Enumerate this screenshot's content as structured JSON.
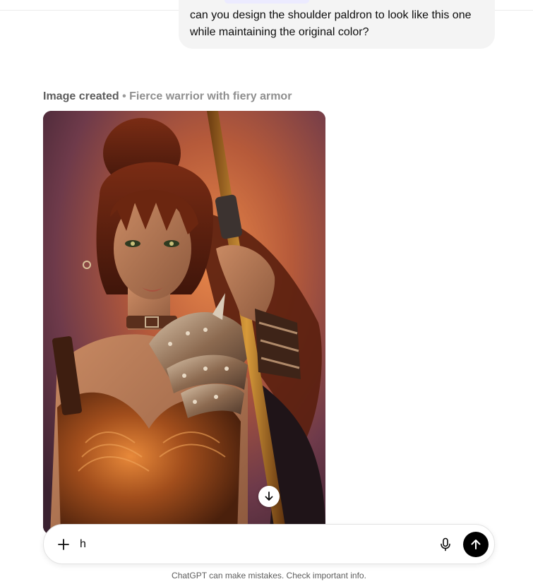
{
  "conversation": {
    "user_message": "can you design the shoulder paldron to look like this one while maintaining the original color?",
    "image_caption": {
      "status": "Image created",
      "separator": "•",
      "title": "Fierce warrior with fiery armor"
    },
    "image": {
      "icon": "download-icon"
    }
  },
  "composer": {
    "value": "h",
    "plus_icon": "plus-icon",
    "mic_icon": "microphone-icon",
    "send_icon": "arrow-up-icon"
  },
  "footer": {
    "disclaimer": "ChatGPT can make mistakes. Check important info."
  },
  "colors": {
    "send_button": "#000000",
    "bubble": "#f4f4f4",
    "caption_status": "#5d5d5d",
    "caption_title": "#8f8f8f"
  }
}
